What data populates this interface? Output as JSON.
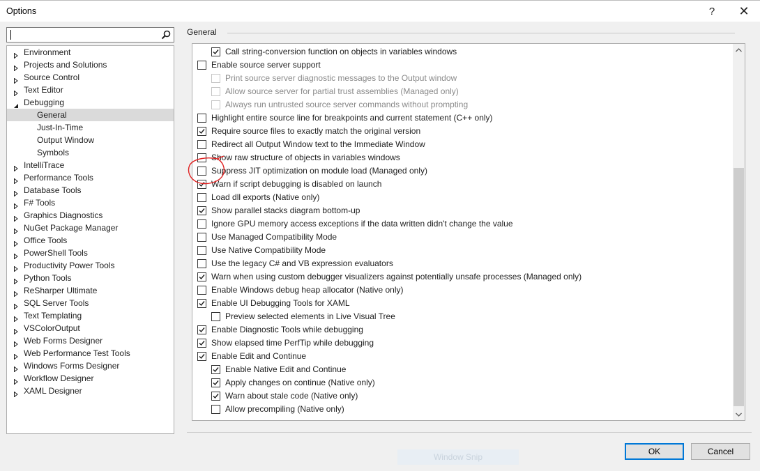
{
  "window": {
    "title": "Options",
    "help_label": "?",
    "close_label": "✕"
  },
  "search": {
    "placeholder": ""
  },
  "tree": [
    {
      "label": "Environment",
      "expanded": false,
      "level": 0
    },
    {
      "label": "Projects and Solutions",
      "expanded": false,
      "level": 0
    },
    {
      "label": "Source Control",
      "expanded": false,
      "level": 0
    },
    {
      "label": "Text Editor",
      "expanded": false,
      "level": 0
    },
    {
      "label": "Debugging",
      "expanded": true,
      "level": 0
    },
    {
      "label": "General",
      "level": 1,
      "selected": true
    },
    {
      "label": "Just-In-Time",
      "level": 1
    },
    {
      "label": "Output Window",
      "level": 1
    },
    {
      "label": "Symbols",
      "level": 1
    },
    {
      "label": "IntelliTrace",
      "expanded": false,
      "level": 0
    },
    {
      "label": "Performance Tools",
      "expanded": false,
      "level": 0
    },
    {
      "label": "Database Tools",
      "expanded": false,
      "level": 0
    },
    {
      "label": "F# Tools",
      "expanded": false,
      "level": 0
    },
    {
      "label": "Graphics Diagnostics",
      "expanded": false,
      "level": 0
    },
    {
      "label": "NuGet Package Manager",
      "expanded": false,
      "level": 0
    },
    {
      "label": "Office Tools",
      "expanded": false,
      "level": 0
    },
    {
      "label": "PowerShell Tools",
      "expanded": false,
      "level": 0
    },
    {
      "label": "Productivity Power Tools",
      "expanded": false,
      "level": 0
    },
    {
      "label": "Python Tools",
      "expanded": false,
      "level": 0
    },
    {
      "label": "ReSharper Ultimate",
      "expanded": false,
      "level": 0
    },
    {
      "label": "SQL Server Tools",
      "expanded": false,
      "level": 0
    },
    {
      "label": "Text Templating",
      "expanded": false,
      "level": 0
    },
    {
      "label": "VSColorOutput",
      "expanded": false,
      "level": 0
    },
    {
      "label": "Web Forms Designer",
      "expanded": false,
      "level": 0
    },
    {
      "label": "Web Performance Test Tools",
      "expanded": false,
      "level": 0
    },
    {
      "label": "Windows Forms Designer",
      "expanded": false,
      "level": 0
    },
    {
      "label": "Workflow Designer",
      "expanded": false,
      "level": 0
    },
    {
      "label": "XAML Designer",
      "expanded": false,
      "level": 0
    }
  ],
  "section": {
    "title": "General"
  },
  "options": [
    {
      "label": "Call string-conversion function on objects in variables windows",
      "checked": true,
      "indent": 1,
      "enabled": true
    },
    {
      "label": "Enable source server support",
      "checked": false,
      "indent": 0,
      "enabled": true
    },
    {
      "label": "Print source server diagnostic messages to the Output window",
      "checked": false,
      "indent": 1,
      "enabled": false
    },
    {
      "label": "Allow source server for partial trust assemblies (Managed only)",
      "checked": false,
      "indent": 1,
      "enabled": false
    },
    {
      "label": "Always run untrusted source server commands without prompting",
      "checked": false,
      "indent": 1,
      "enabled": false
    },
    {
      "label": "Highlight entire source line for breakpoints and current statement (C++ only)",
      "checked": false,
      "indent": 0,
      "enabled": true
    },
    {
      "label": "Require source files to exactly match the original version",
      "checked": true,
      "indent": 0,
      "enabled": true
    },
    {
      "label": "Redirect all Output Window text to the Immediate Window",
      "checked": false,
      "indent": 0,
      "enabled": true
    },
    {
      "label": "Show raw structure of objects in variables windows",
      "checked": false,
      "indent": 0,
      "enabled": true
    },
    {
      "label": "Suppress JIT optimization on module load (Managed only)",
      "checked": false,
      "indent": 0,
      "enabled": true
    },
    {
      "label": "Warn if script debugging is disabled on launch",
      "checked": true,
      "indent": 0,
      "enabled": true
    },
    {
      "label": "Load dll exports (Native only)",
      "checked": false,
      "indent": 0,
      "enabled": true
    },
    {
      "label": "Show parallel stacks diagram bottom-up",
      "checked": true,
      "indent": 0,
      "enabled": true
    },
    {
      "label": "Ignore GPU memory access exceptions if the data written didn't change the value",
      "checked": false,
      "indent": 0,
      "enabled": true
    },
    {
      "label": "Use Managed Compatibility Mode",
      "checked": false,
      "indent": 0,
      "enabled": true
    },
    {
      "label": "Use Native Compatibility Mode",
      "checked": false,
      "indent": 0,
      "enabled": true
    },
    {
      "label": "Use the legacy C# and VB expression evaluators",
      "checked": false,
      "indent": 0,
      "enabled": true
    },
    {
      "label": "Warn when using custom debugger visualizers against potentially unsafe processes (Managed only)",
      "checked": true,
      "indent": 0,
      "enabled": true
    },
    {
      "label": "Enable Windows debug heap allocator (Native only)",
      "checked": false,
      "indent": 0,
      "enabled": true
    },
    {
      "label": "Enable UI Debugging Tools for XAML",
      "checked": true,
      "indent": 0,
      "enabled": true
    },
    {
      "label": "Preview selected elements in Live Visual Tree",
      "checked": false,
      "indent": 1,
      "enabled": true
    },
    {
      "label": "Enable Diagnostic Tools while debugging",
      "checked": true,
      "indent": 0,
      "enabled": true
    },
    {
      "label": "Show elapsed time PerfTip while debugging",
      "checked": true,
      "indent": 0,
      "enabled": true
    },
    {
      "label": "Enable Edit and Continue",
      "checked": true,
      "indent": 0,
      "enabled": true
    },
    {
      "label": "Enable Native Edit and Continue",
      "checked": true,
      "indent": 1,
      "enabled": true
    },
    {
      "label": "Apply changes on continue (Native only)",
      "checked": true,
      "indent": 1,
      "enabled": true
    },
    {
      "label": "Warn about stale code (Native only)",
      "checked": true,
      "indent": 1,
      "enabled": true
    },
    {
      "label": "Allow precompiling (Native only)",
      "checked": false,
      "indent": 1,
      "enabled": true
    }
  ],
  "buttons": {
    "ok": "OK",
    "cancel": "Cancel"
  },
  "watermark": "Window Snip",
  "colors": {
    "accent": "#0078d7",
    "annotation": "#e02020",
    "selection": "#dadada"
  }
}
